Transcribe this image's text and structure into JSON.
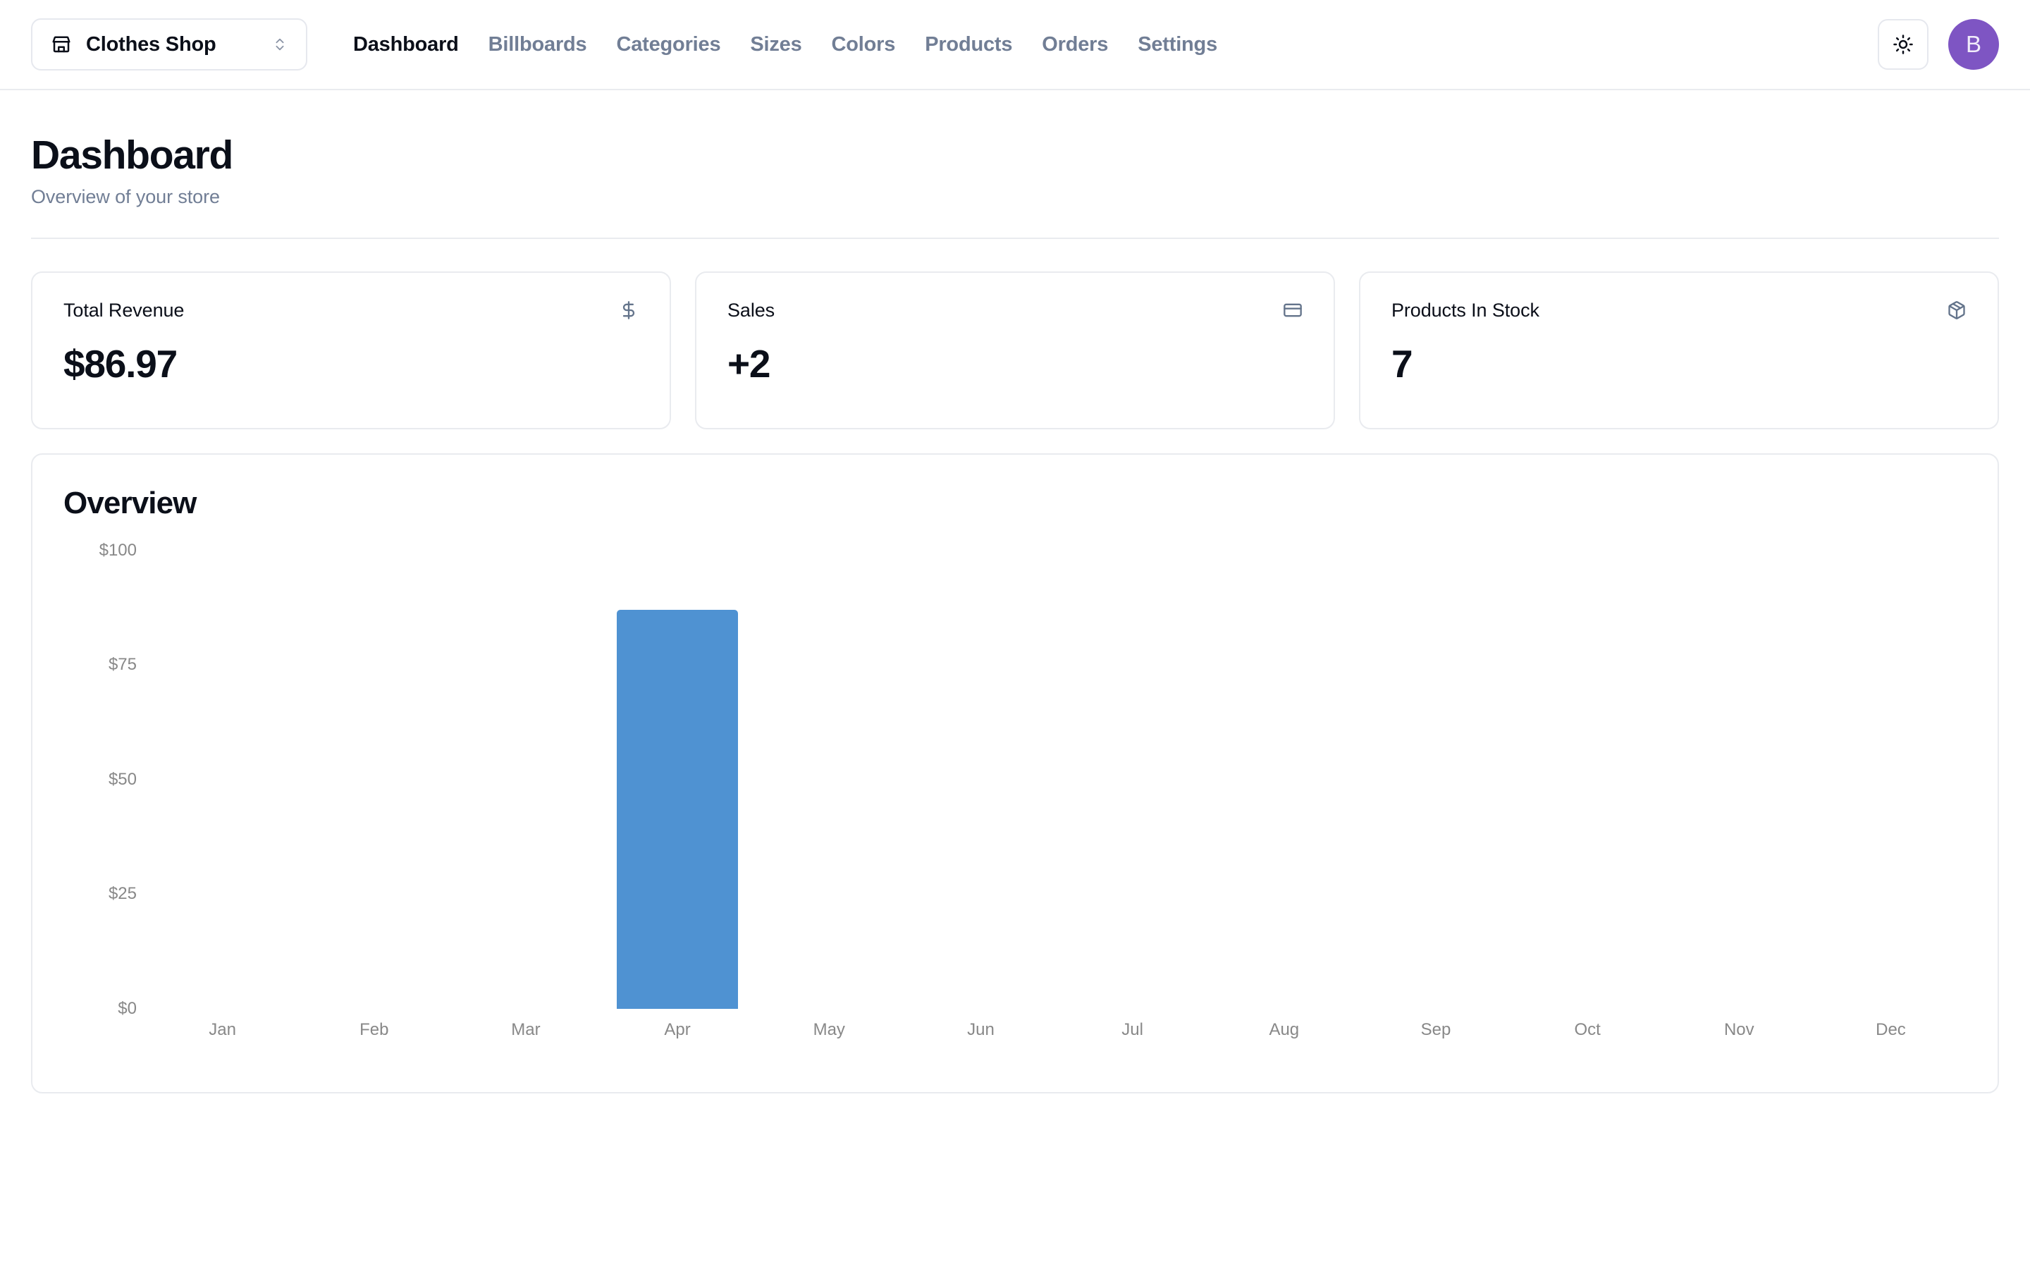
{
  "topbar": {
    "store_switcher": {
      "icon": "store-icon",
      "name": "Clothes Shop",
      "chevron_icon": "chevrons-up-down-icon"
    },
    "nav": [
      {
        "label": "Dashboard",
        "active": true
      },
      {
        "label": "Billboards",
        "active": false
      },
      {
        "label": "Categories",
        "active": false
      },
      {
        "label": "Sizes",
        "active": false
      },
      {
        "label": "Colors",
        "active": false
      },
      {
        "label": "Products",
        "active": false
      },
      {
        "label": "Orders",
        "active": false
      },
      {
        "label": "Settings",
        "active": false
      }
    ],
    "theme_toggle": {
      "icon": "sun-icon"
    },
    "avatar": {
      "initial": "B",
      "color": "#7e55c3"
    }
  },
  "page": {
    "title": "Dashboard",
    "subtitle": "Overview of your store"
  },
  "stats": [
    {
      "label": "Total Revenue",
      "value": "$86.97",
      "icon": "dollar-sign-icon"
    },
    {
      "label": "Sales",
      "value": "+2",
      "icon": "credit-card-icon"
    },
    {
      "label": "Products In Stock",
      "value": "7",
      "icon": "package-icon"
    }
  ],
  "overview": {
    "title": "Overview"
  },
  "chart_data": {
    "type": "bar",
    "title": "Overview",
    "xlabel": "",
    "ylabel": "",
    "categories": [
      "Jan",
      "Feb",
      "Mar",
      "Apr",
      "May",
      "Jun",
      "Jul",
      "Aug",
      "Sep",
      "Oct",
      "Nov",
      "Dec"
    ],
    "values": [
      0,
      0,
      0,
      86.97,
      0,
      0,
      0,
      0,
      0,
      0,
      0,
      0
    ],
    "ytick_labels": [
      "$100",
      "$75",
      "$50",
      "$25",
      "$0"
    ],
    "ytick_values": [
      100,
      75,
      50,
      25,
      0
    ],
    "ylim": [
      0,
      100
    ],
    "grid": false,
    "legend": false,
    "bar_color": "#4f92d2"
  }
}
